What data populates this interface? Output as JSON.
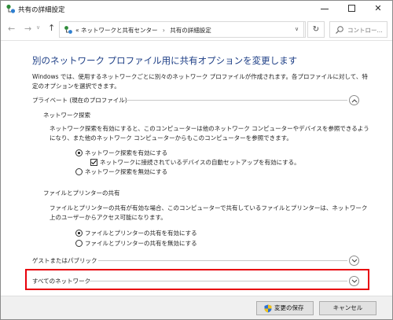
{
  "window": {
    "title": "共有の詳細設定",
    "colors": {
      "heading": "#1e3f86",
      "highlight": "#e8000b",
      "accent": "#0067c0"
    }
  },
  "nav": {
    "back_icon": "back-arrow-icon",
    "forward_icon": "forward-arrow-icon",
    "up_icon": "up-arrow-icon",
    "address_prefix": "«",
    "breadcrumb": [
      "ネットワークと共有センター",
      "共有の詳細設定"
    ],
    "separator": "›",
    "search_placeholder": "コントロー..."
  },
  "main": {
    "heading": "別のネットワーク プロファイル用に共有オプションを変更します",
    "intro": "Windows では、使用するネットワークごとに別々のネットワーク プロファイルが作成されます。各プロファイルに対して、特定のオプションを選択できます。",
    "private": {
      "label": "プライベート (現在のプロファイル)",
      "discovery": {
        "label": "ネットワーク探索",
        "description": "ネットワーク探索を有効にすると、このコンピューターは他のネットワーク コンピューターやデバイスを参照できるようになり、また他のネットワーク コンピューターからもこのコンピューターを参照できます。",
        "option_on": "ネットワーク探索を有効にする",
        "option_auto_setup": "ネットワークに接続されているデバイスの自動セットアップを有効にする。",
        "option_off": "ネットワーク探索を無効にする"
      },
      "sharing": {
        "label": "ファイルとプリンターの共有",
        "description": "ファイルとプリンターの共有が有効な場合、このコンピューターで共有しているファイルとプリンターは、ネットワーク上のユーザーからアクセス可能になります。",
        "option_on": "ファイルとプリンターの共有を有効にする",
        "option_off": "ファイルとプリンターの共有を無効にする"
      }
    },
    "guest": {
      "label": "ゲストまたはパブリック"
    },
    "all": {
      "label": "すべてのネットワーク"
    }
  },
  "footer": {
    "save": "変更の保存",
    "cancel": "キャンセル"
  }
}
